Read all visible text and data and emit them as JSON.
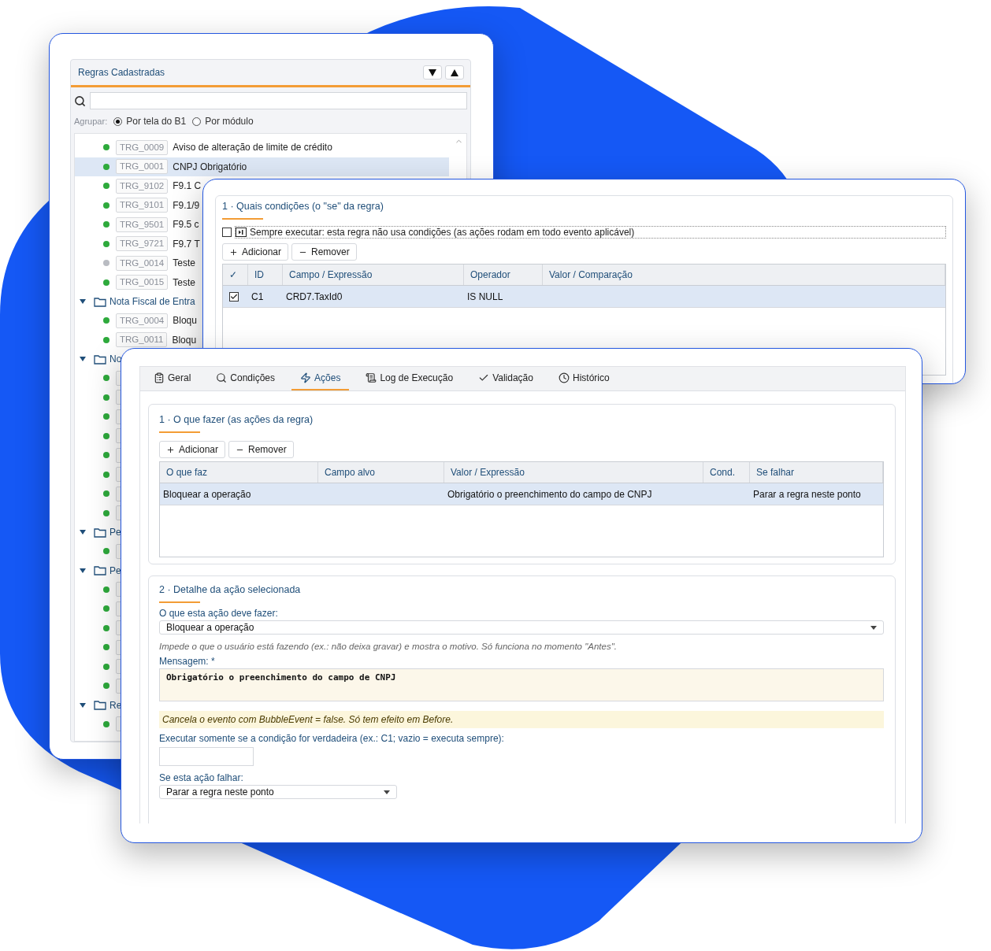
{
  "rules_panel": {
    "title": "Regras Cadastradas",
    "group_label": "Agrupar:",
    "group_options": [
      {
        "label": "Por tela do B1",
        "selected": true
      },
      {
        "label": "Por módulo",
        "selected": false
      }
    ],
    "tree": [
      {
        "kind": "rule",
        "code": "TRG_0009",
        "name": "Aviso de alteração de limite de crédito",
        "active": true,
        "selected": false
      },
      {
        "kind": "rule",
        "code": "TRG_0001",
        "name": "CNPJ Obrigatório",
        "active": true,
        "selected": true
      },
      {
        "kind": "rule",
        "code": "TRG_9102",
        "name": "F9.1 C",
        "active": true,
        "selected": false
      },
      {
        "kind": "rule",
        "code": "TRG_9101",
        "name": "F9.1/9",
        "active": true,
        "selected": false
      },
      {
        "kind": "rule",
        "code": "TRG_9501",
        "name": "F9.5 c",
        "active": true,
        "selected": false
      },
      {
        "kind": "rule",
        "code": "TRG_9721",
        "name": "F9.7 T",
        "active": true,
        "selected": false
      },
      {
        "kind": "rule",
        "code": "TRG_0014",
        "name": "Teste",
        "active": false,
        "selected": false
      },
      {
        "kind": "rule",
        "code": "TRG_0015",
        "name": "Teste",
        "active": true,
        "selected": false
      },
      {
        "kind": "folder",
        "label": "Nota Fiscal de Entra",
        "expanded": true,
        "children": [
          {
            "kind": "rule",
            "code": "TRG_0004",
            "name": "Bloqu",
            "active": true,
            "selected": false
          },
          {
            "kind": "rule",
            "code": "TRG_0011",
            "name": "Bloqu",
            "active": true,
            "selected": false
          }
        ]
      },
      {
        "kind": "folder",
        "label": "No",
        "expanded": true,
        "children": [
          {
            "kind": "rule",
            "active": true,
            "selected": false
          },
          {
            "kind": "rule",
            "active": true,
            "selected": false
          },
          {
            "kind": "rule",
            "active": true,
            "selected": false
          },
          {
            "kind": "rule",
            "active": true,
            "selected": false
          },
          {
            "kind": "rule",
            "active": true,
            "selected": false
          },
          {
            "kind": "rule",
            "active": true,
            "selected": false
          },
          {
            "kind": "rule",
            "active": true,
            "selected": false
          },
          {
            "kind": "rule",
            "active": true,
            "selected": false
          }
        ]
      },
      {
        "kind": "folder",
        "label": "Pe",
        "expanded": true,
        "children": [
          {
            "kind": "rule",
            "active": true,
            "selected": false
          }
        ]
      },
      {
        "kind": "folder",
        "label": "Pe",
        "expanded": true,
        "children": [
          {
            "kind": "rule",
            "active": true,
            "selected": false
          },
          {
            "kind": "rule",
            "active": true,
            "selected": false
          },
          {
            "kind": "rule",
            "active": true,
            "selected": false
          },
          {
            "kind": "rule",
            "active": true,
            "selected": false
          },
          {
            "kind": "rule",
            "active": true,
            "selected": false
          },
          {
            "kind": "rule",
            "active": true,
            "selected": false
          }
        ]
      },
      {
        "kind": "folder",
        "label": "Re",
        "expanded": true,
        "children": [
          {
            "kind": "rule",
            "active": true,
            "selected": false
          }
        ]
      }
    ]
  },
  "conditions": {
    "title": "1 · Quais condições (o \"se\" da regra)",
    "always_run": {
      "label": "Sempre executar: esta regra não usa condições (as ações rodam em todo evento aplicável)",
      "checked": false
    },
    "buttons": [
      "Adicionar",
      "Remover"
    ],
    "columns": [
      "✓",
      "ID",
      "Campo / Expressão",
      "Operador",
      "Valor / Comparação"
    ],
    "rows": [
      {
        "checked": true,
        "selected": true,
        "id": "C1",
        "field": "CRD7.TaxId0",
        "operator": "IS NULL"
      }
    ]
  },
  "editor": {
    "tabs": [
      {
        "label": "Geral",
        "selected": false
      },
      {
        "label": "Condições",
        "selected": false
      },
      {
        "label": "Ações",
        "selected": true
      },
      {
        "label": "Log de Execução",
        "selected": false
      },
      {
        "label": "Validação",
        "selected": false
      },
      {
        "label": "Histórico",
        "selected": false
      }
    ],
    "actions": {
      "title": "1 · O que fazer (as ações da regra)",
      "buttons": [
        "Adicionar",
        "Remover"
      ],
      "columns": [
        "O que faz",
        "Campo alvo",
        "Valor / Expressão",
        "Cond.",
        "Se falhar"
      ],
      "rows": [
        {
          "selected": true,
          "action": "Bloquear a operação",
          "value": "Obrigatório o preenchimento do campo de CNPJ",
          "on_fail": "Parar a regra neste ponto"
        }
      ]
    },
    "detail": {
      "title": "2 · Detalhe da ação selecionada",
      "action_label": "O que esta ação deve fazer:",
      "action_value": "Bloquear a operação",
      "action_hint": "Impede o que o usuário está fazendo (ex.: não deixa gravar) e mostra o motivo. Só funciona no momento \"Antes\".",
      "message_label": "Mensagem: *",
      "message_value": "Obrigatório o preenchimento do campo de CNPJ",
      "notice": "Cancela o evento com BubbleEvent = false. Só tem efeito em Before.",
      "condition_label": "Executar somente se a condição for verdadeira (ex.: C1; vazio = executa sempre):",
      "fail_label": "Se esta ação falhar:",
      "fail_value": "Parar a regra neste ponto"
    }
  }
}
